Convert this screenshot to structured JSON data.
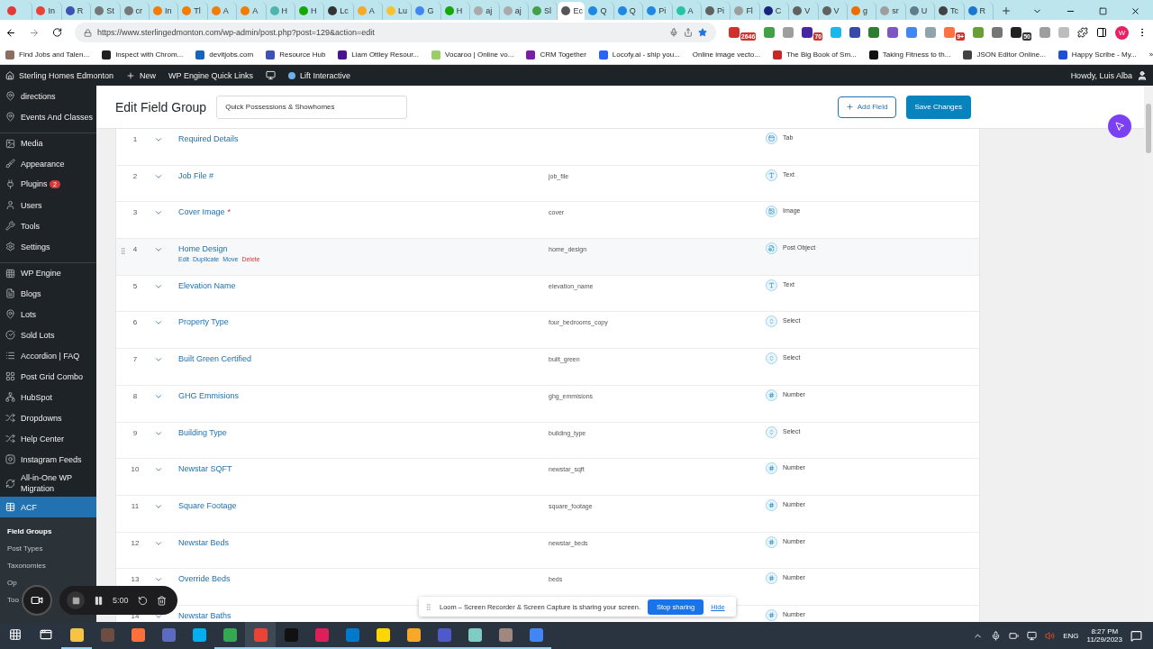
{
  "browser": {
    "tabs": [
      {
        "color": "#e53935",
        "selected": false
      },
      {
        "title": "In",
        "color": "#ea4335",
        "selected": false
      },
      {
        "title": "R",
        "color": "#3f51b5",
        "selected": false
      },
      {
        "title": "St",
        "color": "#777777",
        "selected": false
      },
      {
        "title": "cr",
        "color": "#777777",
        "selected": false
      },
      {
        "title": "In",
        "color": "#f57c00",
        "selected": false
      },
      {
        "title": "Tl",
        "color": "#f57c00",
        "selected": false
      },
      {
        "title": "A",
        "color": "#f57c00",
        "selected": false
      },
      {
        "title": "A",
        "color": "#f57c00",
        "selected": false
      },
      {
        "title": "H",
        "color": "#4db6ac",
        "selected": false
      },
      {
        "title": "H",
        "color": "#14a800",
        "selected": false
      },
      {
        "title": "Lc",
        "color": "#333333",
        "selected": false
      },
      {
        "title": "A",
        "color": "#f9a825",
        "selected": false
      },
      {
        "title": "Lu",
        "color": "#fbc02d",
        "selected": false
      },
      {
        "title": "G",
        "color": "#4285f4",
        "selected": false
      },
      {
        "title": "H",
        "color": "#14a800",
        "selected": false
      },
      {
        "title": "aj",
        "color": "#aaaaaa",
        "selected": false
      },
      {
        "title": "aj",
        "color": "#aaaaaa",
        "selected": false
      },
      {
        "title": "Sl",
        "color": "#43a047",
        "selected": false
      },
      {
        "title": "Ec",
        "color": "#555555",
        "selected": true
      },
      {
        "title": "Q",
        "color": "#1e88e5",
        "selected": false
      },
      {
        "title": "Q",
        "color": "#1e88e5",
        "selected": false
      },
      {
        "title": "Pi",
        "color": "#1e88e5",
        "selected": false
      },
      {
        "title": "A",
        "color": "#26c6a5",
        "selected": false
      },
      {
        "title": "Pi",
        "color": "#616161",
        "selected": false
      },
      {
        "title": "Fl",
        "color": "#9e9e9e",
        "selected": false
      },
      {
        "title": "C",
        "color": "#1a237e",
        "selected": false
      },
      {
        "title": "V",
        "color": "#616161",
        "selected": false
      },
      {
        "title": "V",
        "color": "#616161",
        "selected": false
      },
      {
        "title": "g",
        "color": "#ef6c00",
        "selected": false
      },
      {
        "title": "sr",
        "color": "#9e9e9e",
        "selected": false
      },
      {
        "title": "U",
        "color": "#607d8b",
        "selected": false
      },
      {
        "title": "Tc",
        "color": "#424242",
        "selected": false
      },
      {
        "title": "R",
        "color": "#1976d2",
        "selected": false
      }
    ],
    "url": "https://www.sterlingedmonton.com/wp-admin/post.php?post=129&action=edit",
    "extensions": [
      {
        "color": "#d32f2f",
        "badge": "2646"
      },
      {
        "color": "#43a047"
      },
      {
        "color": "#9e9e9e"
      },
      {
        "color": "#4527a0",
        "badge": "70"
      },
      {
        "color": "#1ab7ea"
      },
      {
        "color": "#3949ab"
      },
      {
        "color": "#2e7d32"
      },
      {
        "color": "#7e57c2"
      },
      {
        "color": "#4285f4"
      },
      {
        "color": "#90a4ae"
      },
      {
        "color": "#ff7043",
        "badge": "9+"
      },
      {
        "color": "#689f38"
      },
      {
        "color": "#757575"
      },
      {
        "color": "#212121",
        "badge": "50"
      },
      {
        "color": "#9e9e9e"
      },
      {
        "color": "#bdbdbd"
      }
    ],
    "profile_initial": "W",
    "bookmarks": [
      {
        "label": "Find Jobs and Talen...",
        "color": "#8d6e63"
      },
      {
        "label": "Inspect with Chrom...",
        "color": "#212121"
      },
      {
        "label": "devitjobs.com",
        "color": "#1565c0"
      },
      {
        "label": "Resource Hub",
        "color": "#3f51b5"
      },
      {
        "label": "Liam Ottley Resour...",
        "color": "#4a148c"
      },
      {
        "label": "Vocaroo | Online vo...",
        "color": "#9ccc65"
      },
      {
        "label": "CRM Together",
        "color": "#7b1fa2"
      },
      {
        "label": "Locofy.ai - ship you...",
        "color": "#2962ff"
      },
      {
        "label": "Online image vecto..."
      },
      {
        "label": "The Big Book of Sm...",
        "color": "#c62828"
      },
      {
        "label": "Taking Fitness to th...",
        "color": "#111111"
      },
      {
        "label": "JSON Editor Online...",
        "color": "#424242"
      },
      {
        "label": "Happy Scribe - My...",
        "color": "#1e4fd8"
      }
    ],
    "bookmarks_more": "»"
  },
  "admin_bar": {
    "items": [
      {
        "kind": "home",
        "label": "Sterling Homes Edmonton"
      },
      {
        "kind": "new",
        "label": "New"
      },
      {
        "kind": "plain",
        "label": "WP Engine Quick Links"
      },
      {
        "kind": "yoast"
      },
      {
        "kind": "dot",
        "label": "Lift Interactive"
      }
    ],
    "greeting": "Howdy, Luis Alba"
  },
  "sidebar": {
    "items": [
      {
        "kind": "pin",
        "label": "directions",
        "selected": false
      },
      {
        "kind": "pin2",
        "label": "Events And Classes",
        "selected": false
      },
      {
        "kind": "media",
        "label": "Media",
        "selected": false,
        "gap": true
      },
      {
        "kind": "brush",
        "label": "Appearance",
        "selected": false
      },
      {
        "kind": "plug",
        "label": "Plugins",
        "badge": "2",
        "selected": false
      },
      {
        "kind": "user",
        "label": "Users",
        "selected": false
      },
      {
        "kind": "wrench",
        "label": "Tools",
        "selected": false
      },
      {
        "kind": "settings",
        "label": "Settings",
        "selected": false
      },
      {
        "kind": "grid",
        "label": "WP Engine",
        "selected": false,
        "gap": true
      },
      {
        "kind": "file",
        "label": "Blogs",
        "selected": false
      },
      {
        "kind": "pin",
        "label": "Lots",
        "selected": false
      },
      {
        "kind": "check",
        "label": "Sold Lots",
        "selected": false
      },
      {
        "kind": "list",
        "label": "Accordion | FAQ",
        "selected": false
      },
      {
        "kind": "layout",
        "label": "Post Grid Combo",
        "selected": false
      },
      {
        "kind": "hub",
        "label": "HubSpot",
        "selected": false
      },
      {
        "kind": "shuffle",
        "label": "Dropdowns",
        "selected": false
      },
      {
        "kind": "shuffle",
        "label": "Help Center",
        "selected": false
      },
      {
        "kind": "insta",
        "label": "Instagram Feeds",
        "selected": false
      },
      {
        "kind": "refresh",
        "label": "All-in-One WP Migration",
        "selected": false
      },
      {
        "kind": "table",
        "label": "ACF",
        "selected": true
      }
    ],
    "submenu": [
      {
        "label": "Field Groups",
        "selected": true
      },
      {
        "label": "Post Types",
        "selected": false
      },
      {
        "label": "Taxonomies",
        "selected": false
      },
      {
        "label": "Op",
        "selected": false
      },
      {
        "label": "Too",
        "selected": false
      }
    ]
  },
  "header": {
    "title": "Edit Field Group",
    "group_title": "Quick Possessions & Showhomes",
    "add_button": "Add Field",
    "save_button": "Save Changes"
  },
  "fields": [
    {
      "number": "1",
      "label": "Required Details",
      "type": "Tab",
      "kind": "tab",
      "hovered": false
    },
    {
      "number": "2",
      "label": "Job File #",
      "name": "job_file",
      "type": "Text",
      "kind": "text",
      "hovered": false
    },
    {
      "number": "3",
      "label": "Cover Image",
      "required_mark": "*",
      "name": "cover",
      "type": "Image",
      "kind": "image",
      "hovered": false
    },
    {
      "number": "4",
      "label": "Home Design",
      "name": "home_design",
      "type": "Post Object",
      "kind": "post_object",
      "hovered": true,
      "actions": [
        {
          "label": "Edit",
          "kind": "normal"
        },
        {
          "label": "Duplicate",
          "kind": "normal"
        },
        {
          "label": "Move",
          "kind": "normal"
        },
        {
          "label": "Delete",
          "kind": "danger"
        }
      ]
    },
    {
      "number": "5",
      "label": "Elevation Name",
      "name": "elevation_name",
      "type": "Text",
      "kind": "text",
      "hovered": false
    },
    {
      "number": "6",
      "label": "Property Type",
      "name": "four_bedrooms_copy",
      "type": "Select",
      "kind": "select",
      "hovered": false
    },
    {
      "number": "7",
      "label": "Built Green Certified",
      "name": "built_green",
      "type": "Select",
      "kind": "select",
      "hovered": false
    },
    {
      "number": "8",
      "label": "GHG Emmisions",
      "name": "ghg_emmisions",
      "type": "Number",
      "kind": "number",
      "hovered": false
    },
    {
      "number": "9",
      "label": "Building Type",
      "name": "building_type",
      "type": "Select",
      "kind": "select",
      "hovered": false
    },
    {
      "number": "10",
      "label": "Newstar SQFT",
      "name": "newstar_sqft",
      "type": "Number",
      "kind": "number",
      "hovered": false
    },
    {
      "number": "11",
      "label": "Square Footage",
      "name": "square_footage",
      "type": "Number",
      "kind": "number",
      "hovered": false
    },
    {
      "number": "12",
      "label": "Newstar Beds",
      "name": "newstar_beds",
      "type": "Number",
      "kind": "number",
      "hovered": false
    },
    {
      "number": "13",
      "label": "Override Beds",
      "name": "beds",
      "type": "Number",
      "kind": "number",
      "hovered": false
    },
    {
      "number": "14",
      "label": "Newstar Baths",
      "type": "Number",
      "kind": "number",
      "hovered": false
    }
  ],
  "loom": {
    "timer": "5:00",
    "message": "Loom – Screen Recorder & Screen Capture is sharing your screen.",
    "stop_button": "Stop sharing",
    "hide_link": "Hide"
  },
  "taskbar": {
    "apps": [
      {
        "color": "#f6c342",
        "open": true
      },
      {
        "color": "#6d4c41",
        "open": false
      },
      {
        "color": "#ff7139",
        "open": false
      },
      {
        "color": "#5c6bc0",
        "open": false
      },
      {
        "color": "#00aff0",
        "open": false
      },
      {
        "color": "#34a853",
        "open": true
      },
      {
        "color": "#ea4335",
        "open": true,
        "selected": true
      },
      {
        "color": "#111111",
        "open": true
      },
      {
        "color": "#e01e5a",
        "open": true
      },
      {
        "color": "#007acc",
        "open": true
      },
      {
        "color": "#ffd600",
        "open": true
      },
      {
        "color": "#f9a825",
        "open": true
      },
      {
        "color": "#5059c9",
        "open": true
      },
      {
        "color": "#80cbc4",
        "open": true
      },
      {
        "color": "#a1887f",
        "open": true
      },
      {
        "color": "#4285f4",
        "open": true
      }
    ],
    "language": "ENG",
    "time": "8:27 PM",
    "date": "11/29/2023"
  }
}
